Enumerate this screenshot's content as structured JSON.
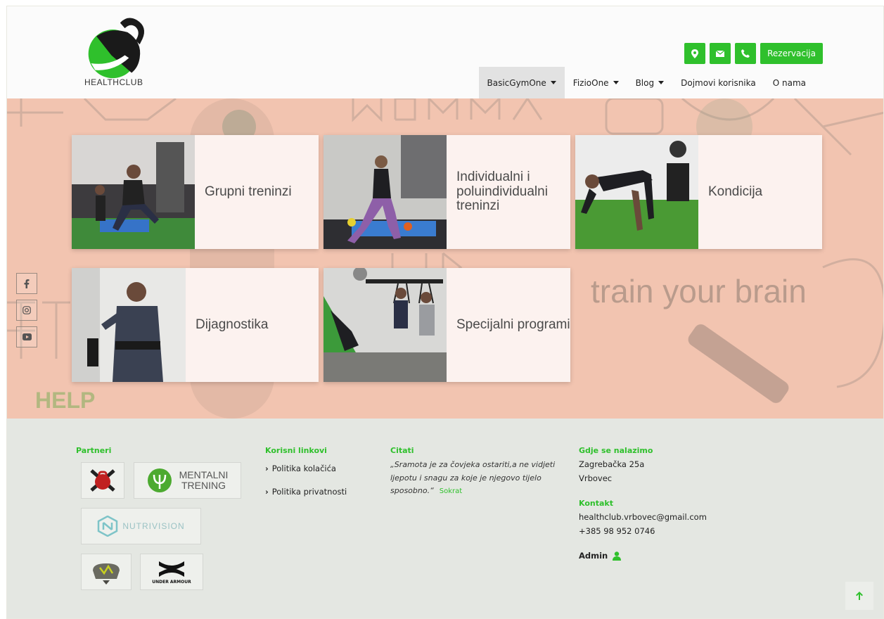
{
  "brand": {
    "name": "HEALTHCLUB",
    "accent": "#2fc02c"
  },
  "header": {
    "icons": [
      "map-marker-icon",
      "envelope-icon",
      "phone-icon"
    ],
    "reserve_label": "Rezervacija",
    "nav": [
      {
        "label": "BasicGymOne",
        "dropdown": true,
        "active": true
      },
      {
        "label": "FizioOne",
        "dropdown": true
      },
      {
        "label": "Blog",
        "dropdown": true
      },
      {
        "label": "Dojmovi korisnika"
      },
      {
        "label": "O nama"
      }
    ]
  },
  "social": [
    "facebook-icon",
    "instagram-icon",
    "youtube-icon"
  ],
  "cards": [
    {
      "title": "Grupni treninzi"
    },
    {
      "title": "Individualni i poluindividualni treninzi"
    },
    {
      "title": "Kondicija"
    },
    {
      "title": "Dijagnostika"
    },
    {
      "title": "Specijalni programi"
    }
  ],
  "footer": {
    "partners_heading": "Partneri",
    "partners": [
      "MENTALNI",
      "TRENING",
      "NUTRIVISION",
      "UNDER ARMOUR"
    ],
    "links_heading": "Korisni linkovi",
    "links": [
      "Politika kolačića",
      "Politika privatnosti"
    ],
    "quotes_heading": "Citati",
    "quote_text": "„Sramota je za čovjeka ostariti,a ne vidjeti ljepotu i snagu za koje je njegovo tijelo sposobno.“",
    "quote_author": "Sokrat",
    "location_heading": "Gdje se nalazimo",
    "address_line1": "Zagrebačka 25a",
    "address_line2": "Vrbovec",
    "contact_heading": "Kontakt",
    "email": "healthclub.vrbovec@gmail.com",
    "phone": "+385 98 952 0746",
    "admin_label": "Admin",
    "to_top_icon": "arrow-up-icon"
  }
}
